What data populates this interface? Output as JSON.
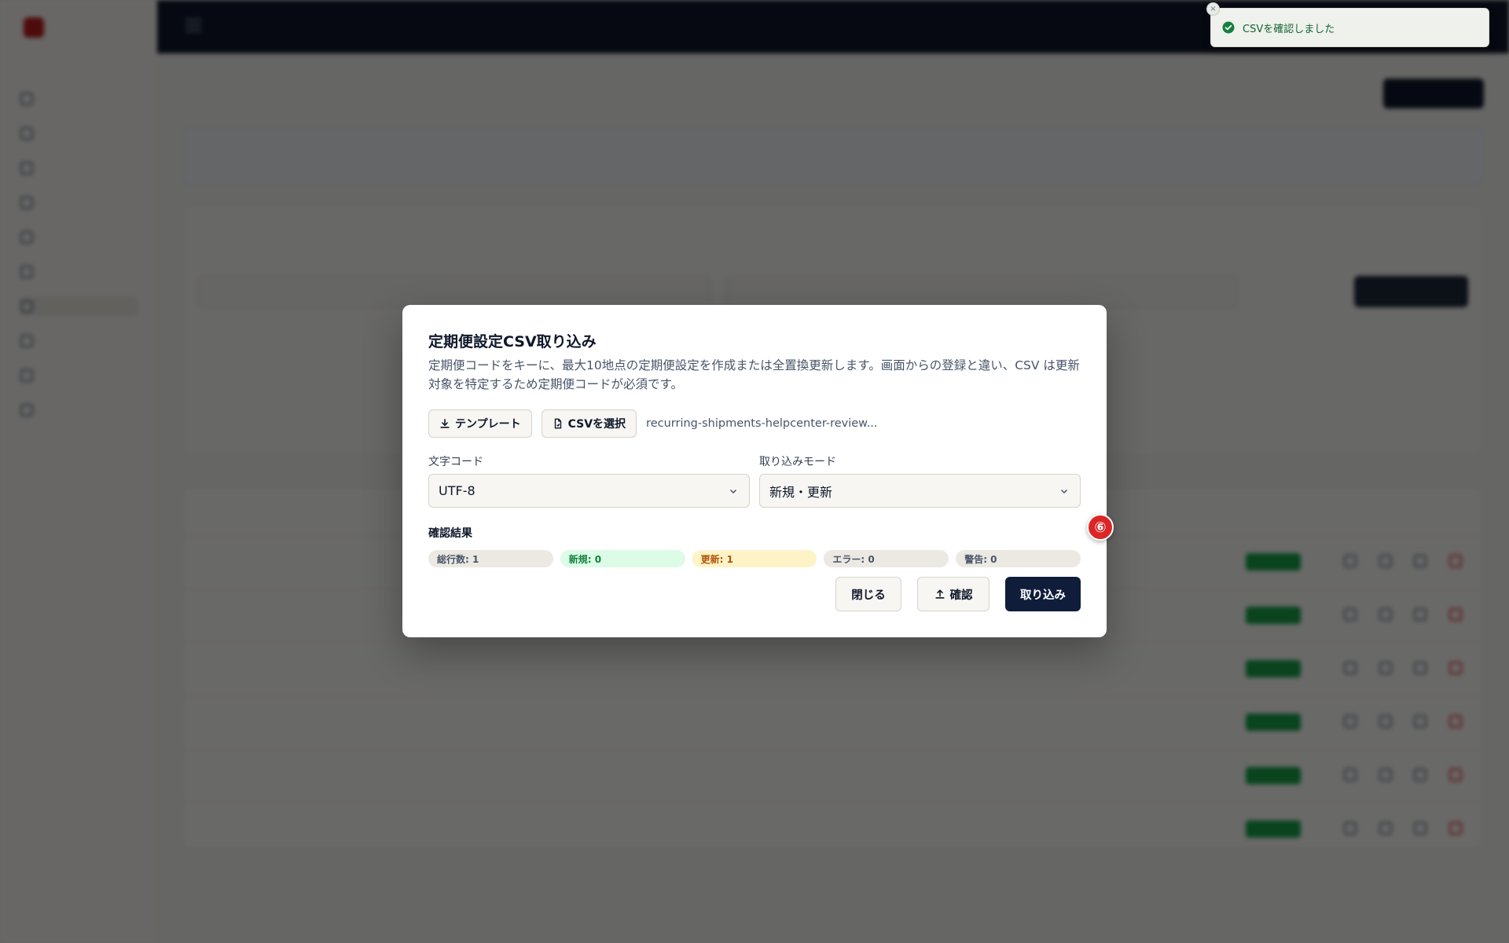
{
  "modal": {
    "title": "定期便設定CSV取り込み",
    "description": "定期便コードをキーに、最大10地点の定期便設定を作成または全置換更新します。画面からの登録と違い、CSV は更新対象を特定するため定期便コードが必須です。",
    "template_button": "テンプレート",
    "select_csv_button": "CSVを選択",
    "selected_file": "recurring-shipments-helpcenter-review...",
    "encoding": {
      "label": "文字コード",
      "value": "UTF-8"
    },
    "mode": {
      "label": "取り込みモード",
      "value": "新規・更新"
    },
    "result_title": "確認結果",
    "chips": [
      {
        "label": "総行数: 1",
        "kind": "neutral"
      },
      {
        "label": "新規: 0",
        "kind": "new"
      },
      {
        "label": "更新: 1",
        "kind": "upd"
      },
      {
        "label": "エラー: 0",
        "kind": "neutral"
      },
      {
        "label": "警告: 0",
        "kind": "neutral"
      }
    ],
    "close_button": "閉じる",
    "confirm_button": "確認",
    "import_button": "取り込み"
  },
  "step_marker": "⑥",
  "toast": {
    "message": "CSVを確認しました",
    "close_glyph": "×"
  },
  "colors": {
    "primary": "#0f1d3a",
    "success": "#15803d",
    "warning": "#b45309",
    "marker": "#dc2626"
  }
}
